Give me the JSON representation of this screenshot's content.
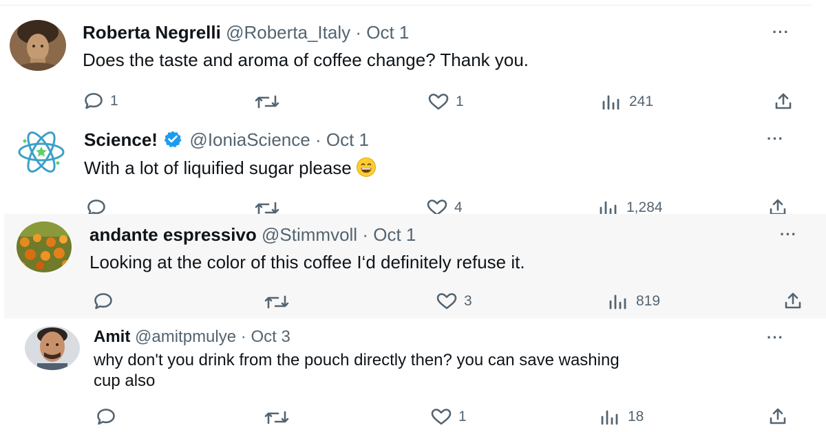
{
  "tweets": [
    {
      "name": "Roberta Negrelli",
      "handle": "@Roberta_Italy",
      "separator": "·",
      "date": "Oct 1",
      "text": "Does the taste and aroma of coffee change? Thank you.",
      "replies": "1",
      "retweets": "",
      "likes": "1",
      "views": "241",
      "more": "···"
    },
    {
      "name": "Science!",
      "handle": "@IoniaScience",
      "separator": "·",
      "date": "Oct 1",
      "text": "With a lot of liquified sugar please",
      "replies": "",
      "retweets": "",
      "likes": "4",
      "views": "1,284",
      "more": "···"
    },
    {
      "name": "andante espressivo",
      "handle": "@Stimmvoll",
      "separator": "·",
      "date": "Oct 1",
      "text": "Looking at the color of this coffee I‘d definitely refuse it.",
      "replies": "",
      "retweets": "",
      "likes": "3",
      "views": "819",
      "more": "···"
    },
    {
      "name": "Amit",
      "handle": "@amitpmulye",
      "separator": "·",
      "date": "Oct 3",
      "text_line1": "why don't you drink from the pouch directly then? you can save washing",
      "text_line2": "cup also",
      "replies": "",
      "retweets": "",
      "likes": "1",
      "views": "18",
      "more": "···"
    }
  ],
  "icons": {
    "reply": "speech-bubble",
    "retweet": "arrows-loop",
    "like": "heart",
    "views": "bar-chart",
    "share": "upload-arrow",
    "verified": "blue-check-badge",
    "emoji": "grinning-face"
  },
  "colors": {
    "text_primary": "#0f1419",
    "text_secondary": "#536471",
    "verified_blue": "#1d9bf0",
    "highlight_background": "#f7f7f7"
  }
}
